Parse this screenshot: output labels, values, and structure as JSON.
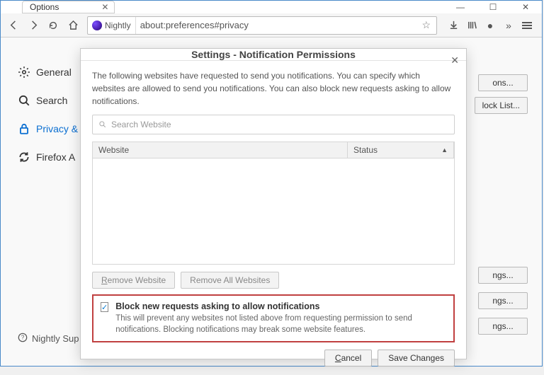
{
  "tab": {
    "title": "Options"
  },
  "urlbar": {
    "identity_label": "Nightly",
    "url": "about:preferences#privacy"
  },
  "sidebar": {
    "items": [
      {
        "label": "General"
      },
      {
        "label": "Search"
      },
      {
        "label": "Privacy &"
      },
      {
        "label": "Firefox A"
      }
    ]
  },
  "footer": {
    "label": "Nightly Sup"
  },
  "right_buttons": {
    "b1": "ons...",
    "b2": "lock List...",
    "b3": "ngs...",
    "b4": "ngs...",
    "b5": "ngs..."
  },
  "dialog": {
    "title": "Settings - Notification Permissions",
    "description": "The following websites have requested to send you notifications. You can specify which websites are allowed to send you notifications. You can also block new requests asking to allow notifications.",
    "search_placeholder": "Search Website",
    "columns": {
      "website": "Website",
      "status": "Status"
    },
    "remove_website": "Remove Website",
    "remove_all": "Remove All Websites",
    "block": {
      "checked": true,
      "title": "Block new requests asking to allow notifications",
      "desc": "This will prevent any websites not listed above from requesting permission to send notifications. Blocking notifications may break some website features."
    },
    "cancel": "Cancel",
    "save": "Save Changes"
  }
}
